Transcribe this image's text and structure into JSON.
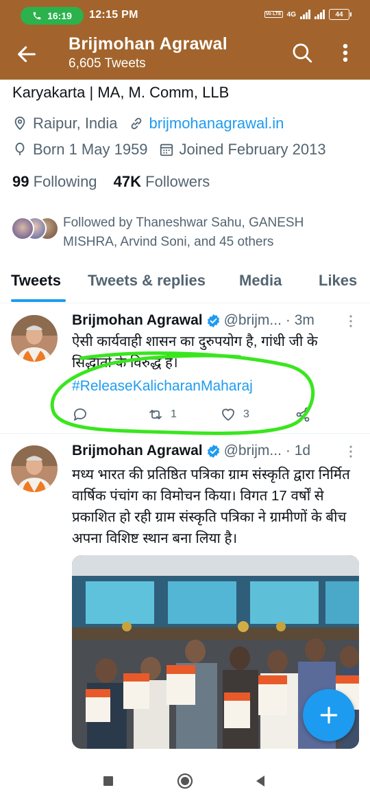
{
  "status_bar": {
    "call_timer": "16:19",
    "clock": "12:15 PM",
    "network": "4G",
    "volte": "Vo LTE",
    "battery": "44"
  },
  "header": {
    "name": "Brijmohan Agrawal",
    "tweet_count": "6,605 Tweets"
  },
  "profile": {
    "bio": "Karyakarta | MA, M. Comm, LLB",
    "location": "Raipur, India",
    "website": "brijmohanagrawal.in",
    "born": "Born 1 May 1959",
    "joined": "Joined February 2013",
    "following_count": "99",
    "following_label": "Following",
    "followers_count": "47K",
    "followers_label": "Followers",
    "followed_by": "Followed by Thaneshwar Sahu, GANESH MISHRA, Arvind Soni, and 45 others"
  },
  "tabs": [
    {
      "label": "Tweets",
      "active": true
    },
    {
      "label": "Tweets & replies",
      "active": false
    },
    {
      "label": "Media",
      "active": false
    },
    {
      "label": "Likes",
      "active": false
    }
  ],
  "tweets": [
    {
      "name": "Brijmohan Agrawal",
      "handle": "@brijm...",
      "time": "· 3m",
      "text": "ऐसी कार्यवाही शासन का दुरुपयोग है, गांधी जी के सिद्धांतों के विरुद्ध है।",
      "hashtag": "#ReleaseKalicharanMaharaj",
      "replies": "",
      "retweets": "1",
      "likes": "3"
    },
    {
      "name": "Brijmohan Agrawal",
      "handle": "@brijm...",
      "time": "· 1d",
      "text": "मध्य भारत की प्रतिष्ठित पत्रिका ग्राम संस्कृति द्वारा निर्मित वार्षिक पंचांग का विमोचन किया। विगत 17 वर्षों से प्रकाशित हो रही ग्राम संस्कृति पत्रिका ने ग्रामीणों के बीच अपना विशिष्ट स्थान बना लिया है।"
    }
  ],
  "colors": {
    "header_bg": "#a2642c",
    "accent": "#1d9bf0",
    "highlight": "#39e61e"
  }
}
